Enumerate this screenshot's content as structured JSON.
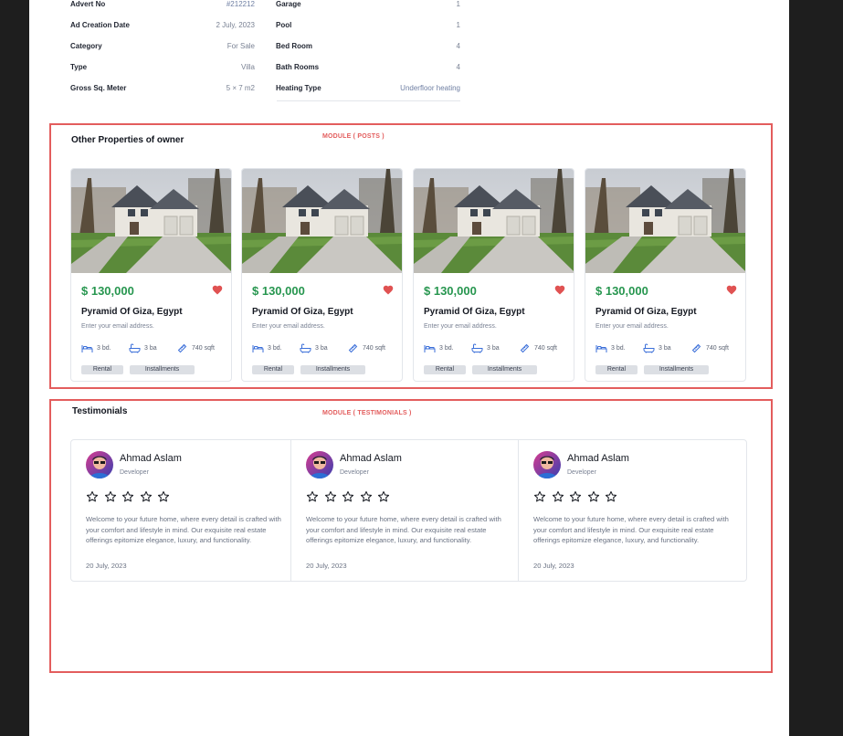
{
  "details": {
    "left": [
      {
        "label": "Advert No",
        "value": "#212212"
      },
      {
        "label": "Ad Creation Date",
        "value": "2 July, 2023"
      },
      {
        "label": "Category",
        "value": "For Sale"
      },
      {
        "label": "Type",
        "value": "Villa"
      },
      {
        "label": "Gross Sq. Meter",
        "value": "5 × 7 m2"
      }
    ],
    "right": [
      {
        "label": "Garage",
        "value": "1"
      },
      {
        "label": "Pool",
        "value": "1"
      },
      {
        "label": "Bed Room",
        "value": "4"
      },
      {
        "label": "Bath Rooms",
        "value": "4"
      },
      {
        "label": "Heating Type",
        "value": "Underfloor heating"
      }
    ]
  },
  "posts_module": {
    "tag": "MODULE ( POSTS )",
    "title": "Other Properties of owner",
    "cards": [
      {
        "price": "$ 130,000",
        "title": "Pyramid Of Giza, Egypt",
        "subtitle": "Enter your email address.",
        "beds": "3 bd.",
        "baths": "3 ba",
        "area": "740 sqft",
        "tags": [
          "Rental",
          "Installments"
        ],
        "favorite": true
      },
      {
        "price": "$ 130,000",
        "title": "Pyramid Of Giza, Egypt",
        "subtitle": "Enter your email address.",
        "beds": "3 bd.",
        "baths": "3 ba",
        "area": "740 sqft",
        "tags": [
          "Rental",
          "Installments"
        ],
        "favorite": true
      },
      {
        "price": "$ 130,000",
        "title": "Pyramid Of Giza, Egypt",
        "subtitle": "Enter your email address.",
        "beds": "3 bd.",
        "baths": "3 ba",
        "area": "740 sqft",
        "tags": [
          "Rental",
          "Installments"
        ],
        "favorite": true
      },
      {
        "price": "$ 130,000",
        "title": "Pyramid Of Giza, Egypt",
        "subtitle": "Enter your email address.",
        "beds": "3 bd.",
        "baths": "3 ba",
        "area": "740 sqft",
        "tags": [
          "Rental",
          "Installments"
        ],
        "favorite": true
      }
    ]
  },
  "testimonials_module": {
    "tag": "MODULE ( TESTIMONIALS )",
    "title": "Testimonials",
    "items": [
      {
        "name": "Ahmad Aslam",
        "role": "Developer",
        "rating": 0,
        "text": "Welcome to your future home, where every detail is crafted with your comfort and lifestyle in mind. Our exquisite real estate offerings epitomize elegance, luxury, and functionality.",
        "date": "20 July, 2023"
      },
      {
        "name": "Ahmad Aslam",
        "role": "Developer",
        "rating": 0,
        "text": "Welcome to your future home, where every detail is crafted with your comfort and lifestyle in mind. Our exquisite real estate offerings epitomize elegance, luxury, and functionality.",
        "date": "20 July, 2023"
      },
      {
        "name": "Ahmad Aslam",
        "role": "Developer",
        "rating": 0,
        "text": "Welcome to your future home, where every detail is crafted with your comfort and lifestyle in mind. Our exquisite real estate offerings epitomize elegance, luxury, and functionality.",
        "date": "20 July, 2023"
      }
    ]
  },
  "colors": {
    "price": "#27964f",
    "heart": "#e05252",
    "module_frame": "#e35d5d"
  },
  "icons": {
    "heart": "heart-icon",
    "bed": "bed-icon",
    "bath": "bath-icon",
    "area": "ruler-icon",
    "star": "star-outline-icon"
  }
}
